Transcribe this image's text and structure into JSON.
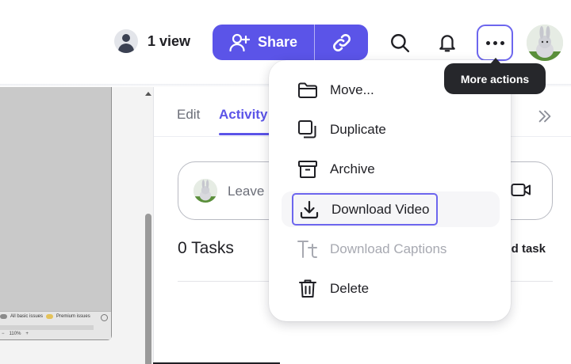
{
  "header": {
    "viewers_label": "1 view",
    "share_label": "Share",
    "accent_color": "#5b54e8"
  },
  "icons": {
    "viewer": "person-avatar-icon",
    "share": "person-add-icon",
    "link": "link-icon",
    "search": "search-icon",
    "notifications": "bell-icon",
    "more": "more-horizontal-icon",
    "user": "bunny-avatar"
  },
  "tooltip": {
    "label": "More actions"
  },
  "document": {
    "legend_basic": "All basic issues",
    "legend_premium": "Premium issues",
    "zoom": "110%"
  },
  "panel": {
    "tabs": [
      {
        "label": "Edit"
      },
      {
        "label": "Activity"
      }
    ],
    "comment_placeholder": "Leave",
    "tasks_title": "0 Tasks",
    "add_task_label": "Add task"
  },
  "menu": {
    "items": [
      {
        "label": "Move...",
        "icon": "folder-icon"
      },
      {
        "label": "Duplicate",
        "icon": "duplicate-icon"
      },
      {
        "label": "Archive",
        "icon": "archive-icon"
      },
      {
        "label": "Download Video",
        "icon": "download-icon"
      },
      {
        "label": "Download Captions",
        "icon": "text-icon",
        "disabled": true
      },
      {
        "label": "Delete",
        "icon": "trash-icon"
      }
    ]
  }
}
